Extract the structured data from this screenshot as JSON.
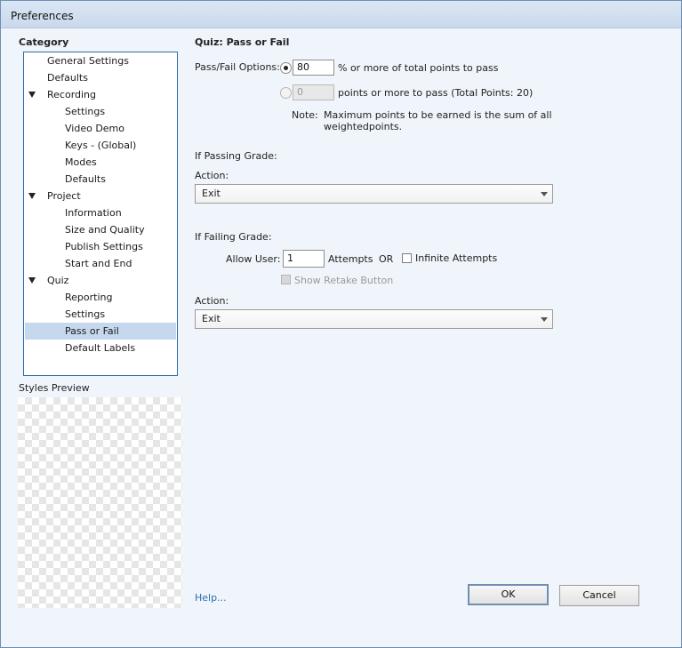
{
  "window": {
    "title": "Preferences"
  },
  "sidebar": {
    "category_heading": "Category",
    "items": [
      {
        "label": "General Settings",
        "level": 1,
        "expandable": false,
        "selected": false
      },
      {
        "label": "Defaults",
        "level": 1,
        "expandable": false,
        "selected": false
      },
      {
        "label": "Recording",
        "level": 1,
        "expandable": true,
        "selected": false
      },
      {
        "label": "Settings",
        "level": 2,
        "expandable": false,
        "selected": false
      },
      {
        "label": "Video Demo",
        "level": 2,
        "expandable": false,
        "selected": false
      },
      {
        "label": "Keys - (Global)",
        "level": 2,
        "expandable": false,
        "selected": false
      },
      {
        "label": "Modes",
        "level": 2,
        "expandable": false,
        "selected": false
      },
      {
        "label": "Defaults",
        "level": 2,
        "expandable": false,
        "selected": false
      },
      {
        "label": "Project",
        "level": 1,
        "expandable": true,
        "selected": false
      },
      {
        "label": "Information",
        "level": 2,
        "expandable": false,
        "selected": false
      },
      {
        "label": "Size and Quality",
        "level": 2,
        "expandable": false,
        "selected": false
      },
      {
        "label": "Publish Settings",
        "level": 2,
        "expandable": false,
        "selected": false
      },
      {
        "label": "Start and End",
        "level": 2,
        "expandable": false,
        "selected": false
      },
      {
        "label": "Quiz",
        "level": 1,
        "expandable": true,
        "selected": false
      },
      {
        "label": "Reporting",
        "level": 2,
        "expandable": false,
        "selected": false
      },
      {
        "label": "Settings",
        "level": 2,
        "expandable": false,
        "selected": false
      },
      {
        "label": "Pass or Fail",
        "level": 2,
        "expandable": false,
        "selected": true
      },
      {
        "label": "Default Labels",
        "level": 2,
        "expandable": false,
        "selected": false
      }
    ],
    "styles_preview_label": "Styles Preview"
  },
  "main": {
    "heading": "Quiz: Pass or Fail",
    "pass_fail_label": "Pass/Fail Options:",
    "percent_option": {
      "value": "80",
      "suffix": "% or more of total points to pass",
      "selected": true
    },
    "points_option": {
      "value": "0",
      "suffix": "points or more to pass (Total Points: 20)",
      "selected": false
    },
    "note_label": "Note:",
    "note_line1": "Maximum points to be earned is the sum of all",
    "note_line2": "weightedpoints.",
    "passing": {
      "heading": "If Passing Grade:",
      "action_label": "Action:",
      "action_value": "Exit"
    },
    "failing": {
      "heading": "If Failing Grade:",
      "allow_user_label": "Allow User:",
      "attempts_value": "1",
      "attempts_label": "Attempts",
      "or_label": "OR",
      "infinite_label": "Infinite Attempts",
      "infinite_checked": false,
      "retake_label": "Show Retake Button",
      "retake_checked": false,
      "action_label": "Action:",
      "action_value": "Exit"
    }
  },
  "footer": {
    "help_link": "Help...",
    "ok_label": "OK",
    "cancel_label": "Cancel"
  }
}
